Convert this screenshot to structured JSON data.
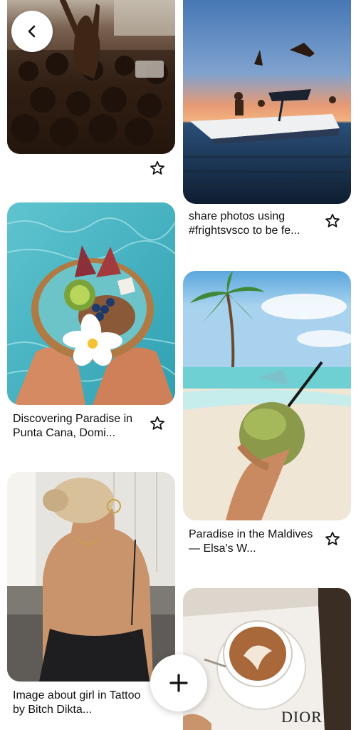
{
  "nav": {
    "back_icon": "chevron-left-icon",
    "add_icon": "plus-icon"
  },
  "pins": {
    "concert": {
      "caption": ""
    },
    "boat": {
      "caption": "share photos using #frightsvsco to be fe..."
    },
    "smoothie": {
      "caption": "Discovering Paradise in Punta Cana, Domi..."
    },
    "maldives": {
      "caption": "Paradise in the Maldives — Elsa's W..."
    },
    "girl": {
      "caption": "Image about girl in Tattoo by Bitch Dikta..."
    },
    "coffee": {
      "caption": "",
      "cup_text": "DIOR"
    }
  },
  "icons": {
    "save": "star-icon"
  }
}
